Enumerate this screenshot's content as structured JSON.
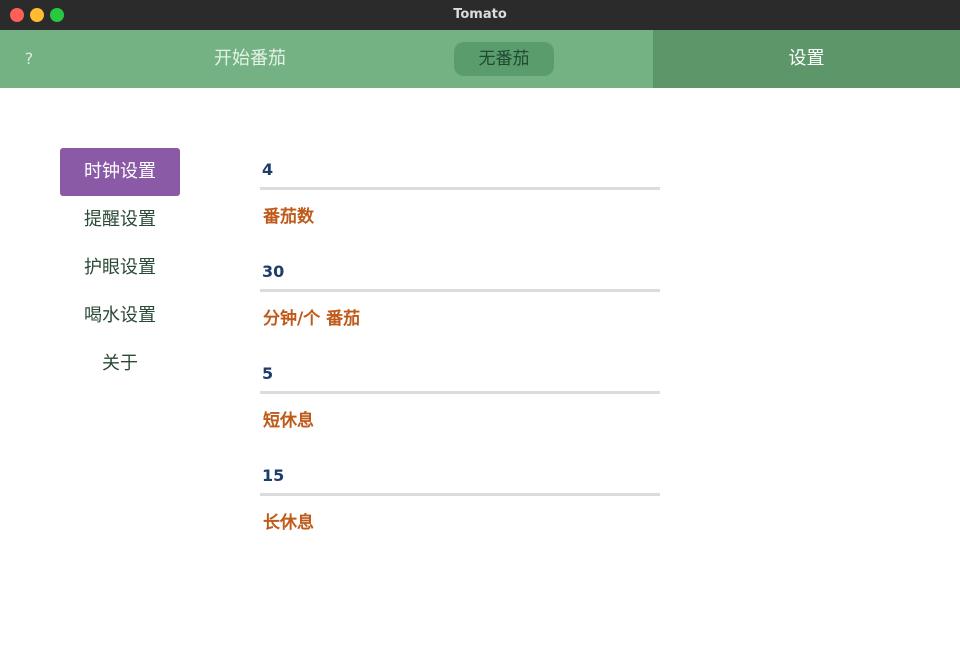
{
  "window": {
    "title": "Tomato"
  },
  "topbar": {
    "help_label": "?",
    "start_label": "开始番茄",
    "status_label": "无番茄",
    "settings_label": "设置"
  },
  "sidebar": {
    "items": [
      {
        "label": "时钟设置",
        "active": true
      },
      {
        "label": "提醒设置",
        "active": false
      },
      {
        "label": "护眼设置",
        "active": false
      },
      {
        "label": "喝水设置",
        "active": false
      },
      {
        "label": "关于",
        "active": false
      }
    ]
  },
  "fields": [
    {
      "value": "4",
      "label": "番茄数"
    },
    {
      "value": "30",
      "label": "分钟/个 番茄"
    },
    {
      "value": "5",
      "label": "短休息"
    },
    {
      "value": "15",
      "label": "长休息"
    }
  ],
  "colors": {
    "topbar": "#74b283",
    "settings_tab": "#5c9669",
    "active_nav": "#8a5aa6",
    "value_text": "#1d3d6b",
    "label_text": "#bf5a1a"
  }
}
